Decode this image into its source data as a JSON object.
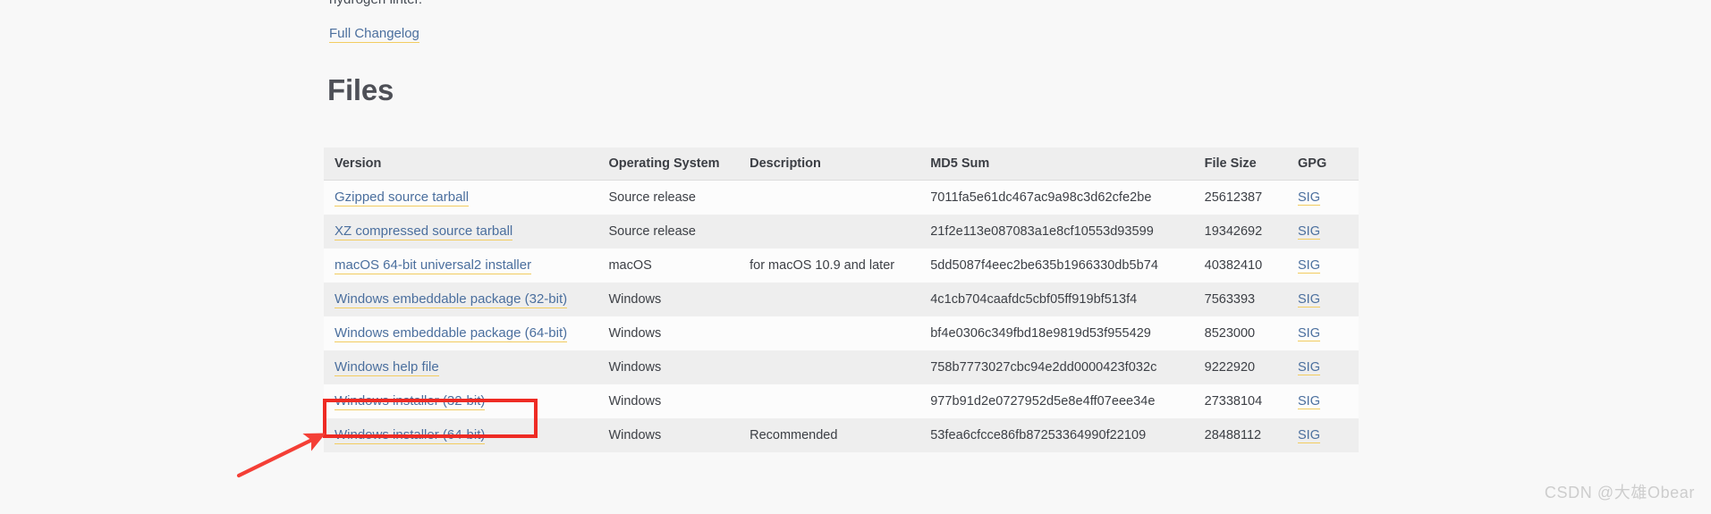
{
  "page": {
    "background_color": "#f8f8f8",
    "clipped_text_top": "hydrogen linter."
  },
  "changelog": {
    "label": "Full Changelog"
  },
  "section": {
    "heading": "Files"
  },
  "table": {
    "columns": [
      "Version",
      "Operating System",
      "Description",
      "MD5 Sum",
      "File Size",
      "GPG"
    ],
    "rows": [
      {
        "version": "Gzipped source tarball",
        "os": "Source release",
        "description": "",
        "md5": "7011fa5e61dc467ac9a98c3d62cfe2be",
        "size": "25612387",
        "gpg": "SIG"
      },
      {
        "version": "XZ compressed source tarball",
        "os": "Source release",
        "description": "",
        "md5": "21f2e113e087083a1e8cf10553d93599",
        "size": "19342692",
        "gpg": "SIG"
      },
      {
        "version": "macOS 64-bit universal2 installer",
        "os": "macOS",
        "description": "for macOS 10.9 and later",
        "md5": "5dd5087f4eec2be635b1966330db5b74",
        "size": "40382410",
        "gpg": "SIG"
      },
      {
        "version": "Windows embeddable package (32-bit)",
        "os": "Windows",
        "description": "",
        "md5": "4c1cb704caafdc5cbf05ff919bf513f4",
        "size": "7563393",
        "gpg": "SIG"
      },
      {
        "version": "Windows embeddable package (64-bit)",
        "os": "Windows",
        "description": "",
        "md5": "bf4e0306c349fbd18e9819d53f955429",
        "size": "8523000",
        "gpg": "SIG"
      },
      {
        "version": "Windows help file",
        "os": "Windows",
        "description": "",
        "md5": "758b7773027cbc94e2dd0000423f032c",
        "size": "9222920",
        "gpg": "SIG"
      },
      {
        "version": "Windows installer (32-bit)",
        "os": "Windows",
        "description": "",
        "md5": "977b91d2e0727952d5e8e4ff07eee34e",
        "size": "27338104",
        "gpg": "SIG"
      },
      {
        "version": "Windows installer (64-bit)",
        "os": "Windows",
        "description": "Recommended",
        "md5": "53fea6cfcce86fb87253364990f22109",
        "size": "28488112",
        "gpg": "SIG"
      }
    ]
  },
  "annotation": {
    "color": "#ee2b24",
    "highlighted_row_version": "Windows installer (64-bit)"
  },
  "watermark": {
    "text": "CSDN @大雄Obear"
  },
  "colors": {
    "link": "#4b6f9e",
    "link_underline": "#f2cc60",
    "header_bg": "#eeeeee",
    "row_alt_bg": "#eeeeee",
    "row_bg": "#fcfcfc",
    "heading": "#4e5057",
    "annotation_red": "#ee2b24"
  }
}
